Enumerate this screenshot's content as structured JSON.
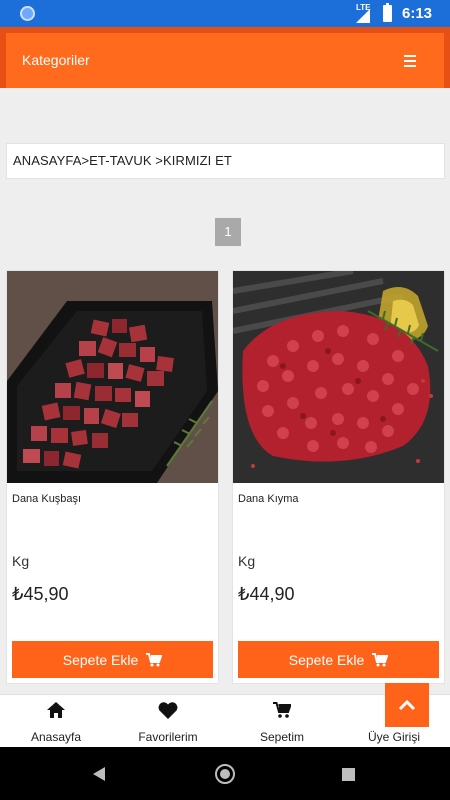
{
  "status_bar": {
    "time": "6:13",
    "network": "LTE"
  },
  "header": {
    "title": "Kategoriler",
    "menu_icon": "hamburger-menu-icon"
  },
  "breadcrumb": "ANASAYFA>ET-TAVUK >KIRMIZI ET",
  "pagination": {
    "current_page": "1"
  },
  "products": [
    {
      "name": "Dana Kuşbaşı",
      "unit": "Kg",
      "price": "₺45,90",
      "button_label": "Sepete Ekle"
    },
    {
      "name": "Dana Kıyma",
      "unit": "Kg",
      "price": "₺44,90",
      "button_label": "Sepete Ekle"
    }
  ],
  "bottom_nav": [
    {
      "label": "Anasayfa",
      "icon": "home-icon"
    },
    {
      "label": "Favorilerim",
      "icon": "heart-icon"
    },
    {
      "label": "Sepetim",
      "icon": "cart-icon"
    },
    {
      "label": "Üye Girişi",
      "icon": "user-icon"
    }
  ],
  "colors": {
    "accent": "#ff6319",
    "header": "#ff6a1d",
    "status_bar": "#1c6fd8"
  }
}
